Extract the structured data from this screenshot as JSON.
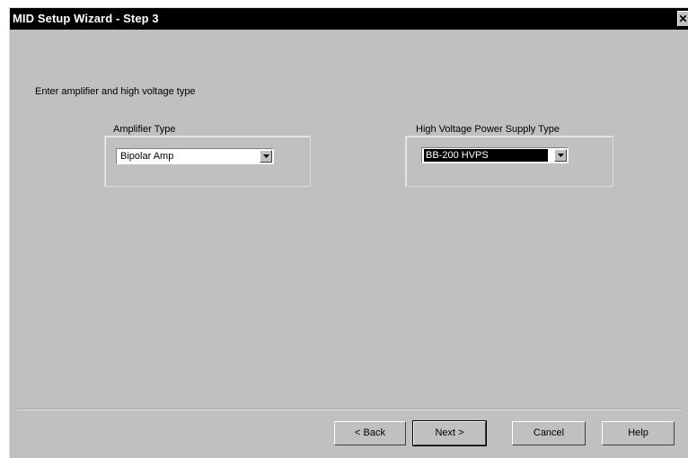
{
  "window": {
    "title": "MID Setup Wizard - Step 3",
    "close_symbol": "✕"
  },
  "instruction": "Enter amplifier and high voltage type",
  "amplifier": {
    "label": "Amplifier Type",
    "selected": "Bipolar Amp"
  },
  "hvps": {
    "label": "High Voltage Power Supply Type",
    "selected": "BB-200 HVPS"
  },
  "buttons": {
    "back": "< Back",
    "next": "Next >",
    "cancel": "Cancel",
    "help": "Help"
  }
}
